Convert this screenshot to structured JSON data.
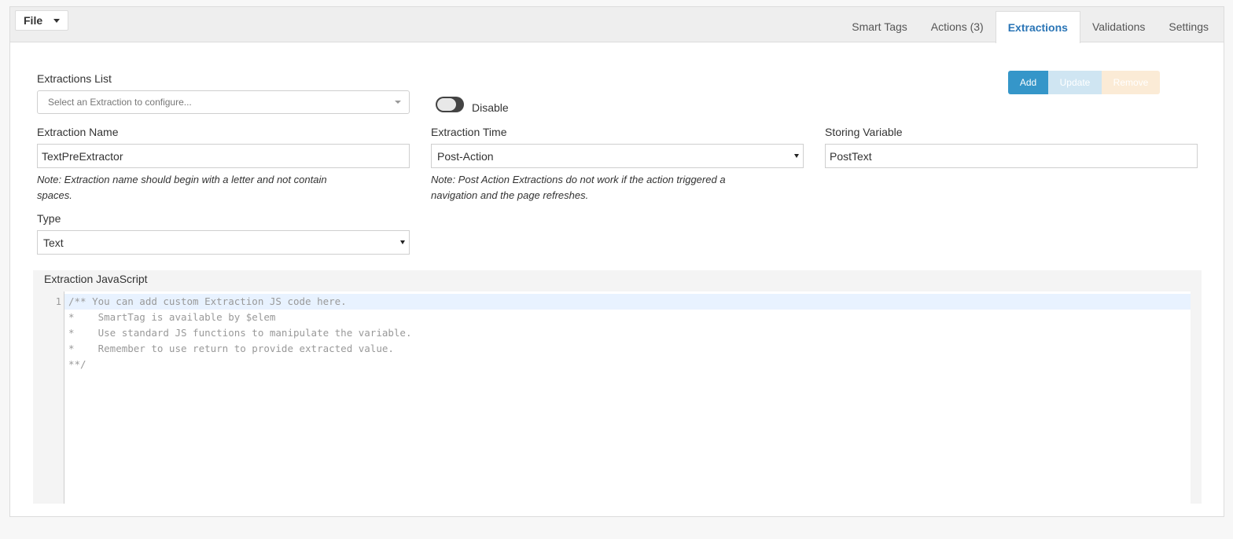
{
  "toolbar": {
    "file_label": "File"
  },
  "tabs": [
    {
      "label": "Smart Tags",
      "active": false
    },
    {
      "label": "Actions (3)",
      "active": false
    },
    {
      "label": "Extractions",
      "active": true
    },
    {
      "label": "Validations",
      "active": false
    },
    {
      "label": "Settings",
      "active": false
    }
  ],
  "extractions_list": {
    "label": "Extractions List",
    "placeholder": "Select an Extraction to configure..."
  },
  "disable_toggle": {
    "label": "Disable",
    "enabled": false
  },
  "buttons": {
    "add": "Add",
    "update": "Update",
    "remove": "Remove"
  },
  "extraction_name": {
    "label": "Extraction Name",
    "value": "TextPreExtractor",
    "note_line1": "Note: Extraction name should begin with a letter and not contain",
    "note_line2": "spaces."
  },
  "extraction_time": {
    "label": "Extraction Time",
    "value": "Post-Action",
    "note_line1": "Note: Post Action Extractions do not work if the action triggered a",
    "note_line2": "navigation and the page refreshes."
  },
  "storing_variable": {
    "label": "Storing Variable",
    "value": "PostText"
  },
  "type": {
    "label": "Type",
    "value": "Text"
  },
  "editor": {
    "label": "Extraction JavaScript",
    "line_number": "1",
    "lines": [
      "/** You can add custom Extraction JS code here.",
      "*    SmartTag is available by $elem",
      "*    Use standard JS functions to manipulate the variable.",
      "*    Remember to use return to provide extracted value.",
      "**/"
    ]
  },
  "colors": {
    "accent": "#2a75b6",
    "add_button": "#3596c9",
    "update_button_disabled": "#cfe5f2",
    "remove_button_disabled": "#fbebd6"
  }
}
